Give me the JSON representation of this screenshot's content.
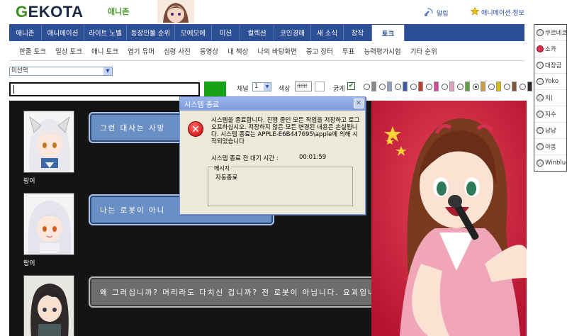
{
  "header": {
    "logo_letter": "G",
    "logo_rest": "EKOTA",
    "logo_sub": "애니존",
    "alarm_label": "알림",
    "info_label": "애니메이션 정보"
  },
  "main_nav": [
    {
      "label": "애니존",
      "w": 46
    },
    {
      "label": "애니메이션",
      "w": 60
    },
    {
      "label": "라이트 노벨",
      "w": 60
    },
    {
      "label": "등장인물 순위",
      "w": 68
    },
    {
      "label": "모에모에",
      "w": 52
    },
    {
      "label": "미션",
      "w": 40
    },
    {
      "label": "컬렉션",
      "w": 48
    },
    {
      "label": "코인경매",
      "w": 52
    },
    {
      "label": "새 소식",
      "w": 46
    },
    {
      "label": "창작",
      "w": 40
    },
    {
      "label": "토크",
      "w": 46,
      "active": true
    }
  ],
  "sub_nav": [
    "한줄 토크",
    "일상 토크",
    "애니 토크",
    "엽기 유머",
    "심령 사진",
    "동영상",
    "내 책상",
    "나의 바탕화면",
    "중고 장터",
    "투표",
    "능력평가시험",
    "기타 순위"
  ],
  "filter_select": "미선택",
  "toolbar": {
    "channel_label": "채널",
    "channel_value": "1",
    "color_label": "색상",
    "color_value": "ffffff",
    "bold_label": "굵게",
    "bold_check": "✔"
  },
  "swatch_colors": [
    "#888888",
    "#8fa0b8",
    "#3a5aa8",
    "#b84030",
    "#d04a9a",
    "#e0a0c0",
    "#60a040",
    "#c8a040",
    "#d8c000",
    "#7a5a3a",
    "#302828"
  ],
  "messages": [
    {
      "user": "랑이",
      "text": "그런 대사는 사망"
    },
    {
      "user": "랑이",
      "text": "나는 로봇이 아니"
    },
    {
      "user": "",
      "text": "왜 그러십니까? 머리라도 다치신 겁니까? 전 로봇이 아닙니다. 요괴입니다."
    }
  ],
  "users": [
    {
      "name": "쿠르네코",
      "icon": "ⓘ"
    },
    {
      "name": "소카",
      "icon": ""
    },
    {
      "name": "대장금",
      "icon": "ⓘ"
    },
    {
      "name": "Yoko",
      "icon": "ⓘ"
    },
    {
      "name": "치(",
      "icon": "ⓘ"
    },
    {
      "name": "지수",
      "icon": "ⓘ"
    },
    {
      "name": "냥냥",
      "icon": "ⓘ"
    },
    {
      "name": "야옹",
      "icon": "ⓘ"
    },
    {
      "name": "Winblue",
      "icon": "ⓘ"
    }
  ],
  "dialog": {
    "title": "시스템 종료",
    "close": "✕",
    "error_glyph": "✕",
    "message": "시스템을 종료합니다. 진행 중인 모든 작업을 저장하고 로그오프하십시오. 저장하지 않은 모든 변경된 내용은 손실됩니다. 시스템 종료는 APPLE-E6B447695\\apple에 의해 시작되었습니다",
    "countdown_label": "시스템 종료 전 대기 시간 :",
    "countdown_value": "00:01:59",
    "box_label": "메시지",
    "box_text": "자동종료"
  }
}
